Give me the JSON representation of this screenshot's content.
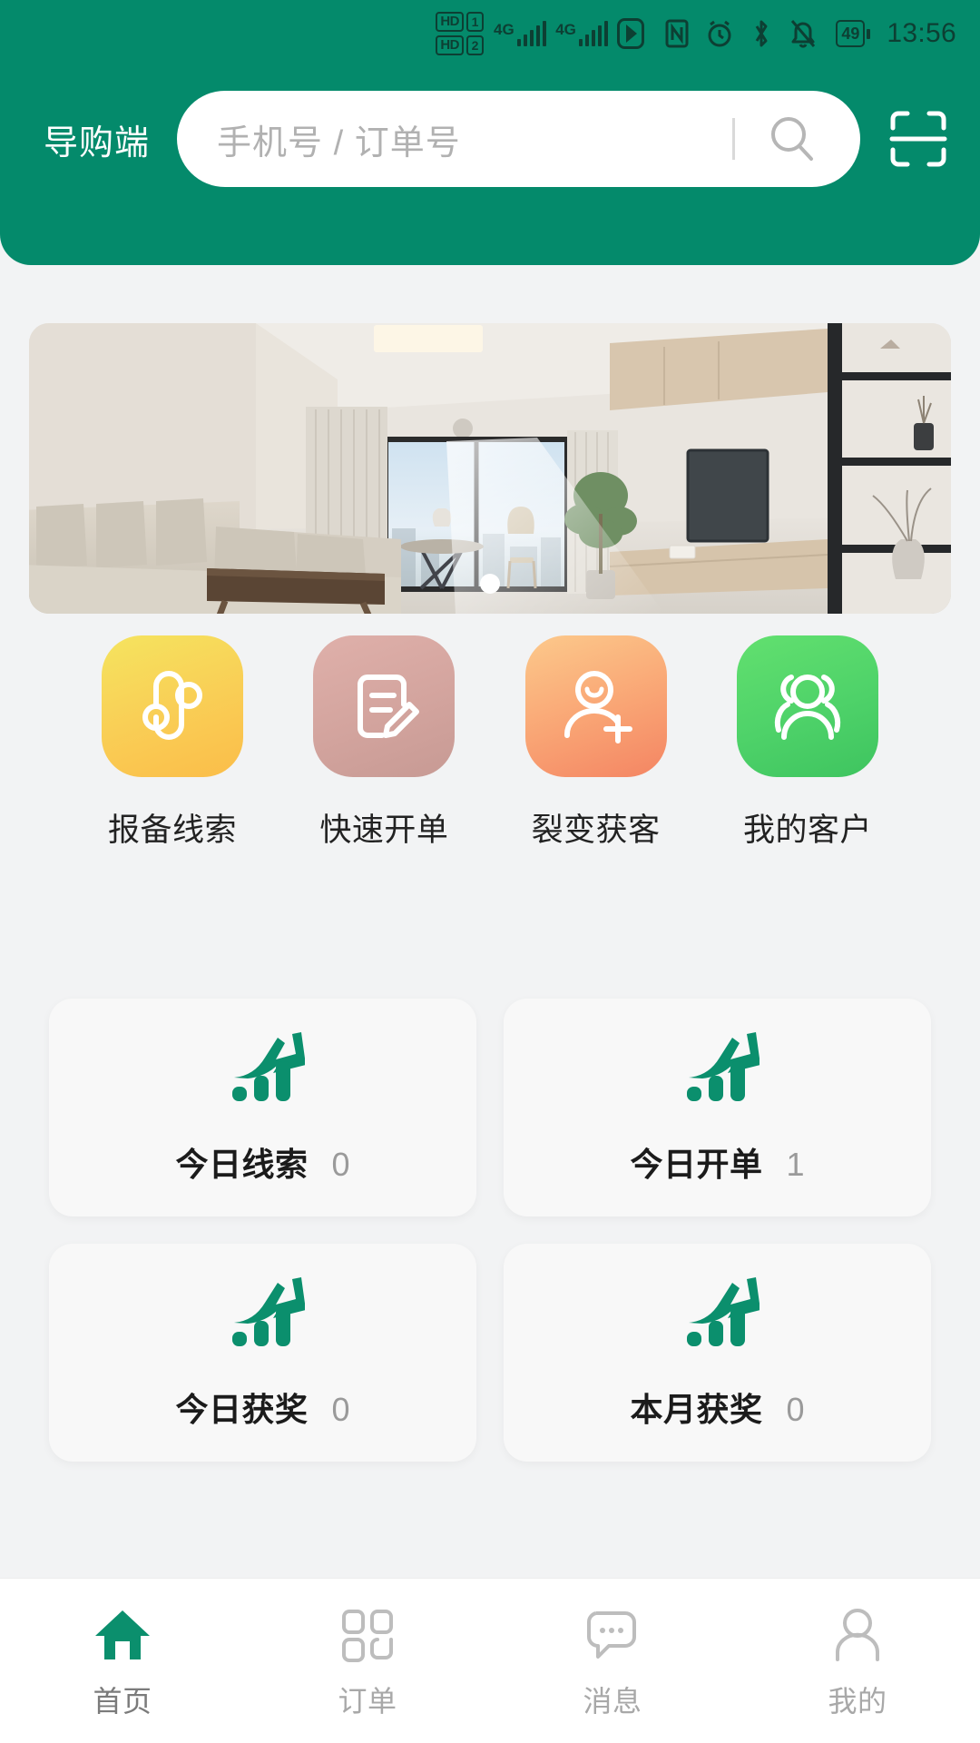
{
  "status_bar": {
    "hd_slot1": "HD",
    "hd_slot1_num": "1",
    "hd_slot2": "HD",
    "hd_slot2_num": "2",
    "sim1_network": "4G",
    "sim2_network": "4G",
    "icons": [
      "vpn-icon",
      "nfc-icon",
      "alarm-icon",
      "bluetooth-icon",
      "mute-icon"
    ],
    "battery_percent": "49",
    "time": "13:56"
  },
  "header": {
    "brand": "导购端",
    "search_placeholder": "手机号 / 订单号",
    "search_value": "",
    "search_icon": "search-icon",
    "scan_icon": "scan-icon",
    "background_color": "#048a6b"
  },
  "banner": {
    "alt": "现代客厅室内效果图",
    "current_index": 1,
    "total": 1
  },
  "quick_actions": [
    {
      "label": "报备线索",
      "icon": "clue-report-icon",
      "color": "#f9cf56"
    },
    {
      "label": "快速开单",
      "icon": "order-edit-icon",
      "color": "#d3a49e"
    },
    {
      "label": "裂变获客",
      "icon": "add-customer-icon",
      "color": "#f9a474"
    },
    {
      "label": "我的客户",
      "icon": "customers-group-icon",
      "color": "#4ed269"
    }
  ],
  "stats": [
    {
      "label": "今日线索",
      "value": "0",
      "icon": "growth-chart-icon"
    },
    {
      "label": "今日开单",
      "value": "1",
      "icon": "growth-chart-icon"
    },
    {
      "label": "今日获奖",
      "value": "0",
      "icon": "growth-chart-icon"
    },
    {
      "label": "本月获奖",
      "value": "0",
      "icon": "growth-chart-icon"
    }
  ],
  "tabbar": [
    {
      "label": "首页",
      "icon": "home-icon",
      "active": true
    },
    {
      "label": "订单",
      "icon": "grid-orders-icon",
      "active": false
    },
    {
      "label": "消息",
      "icon": "chat-message-icon",
      "active": false
    },
    {
      "label": "我的",
      "icon": "profile-person-icon",
      "active": false
    }
  ],
  "theme": {
    "primary": "#048a6b",
    "accent_green": "#0b8f6d",
    "inactive": "#bdbdbd"
  }
}
